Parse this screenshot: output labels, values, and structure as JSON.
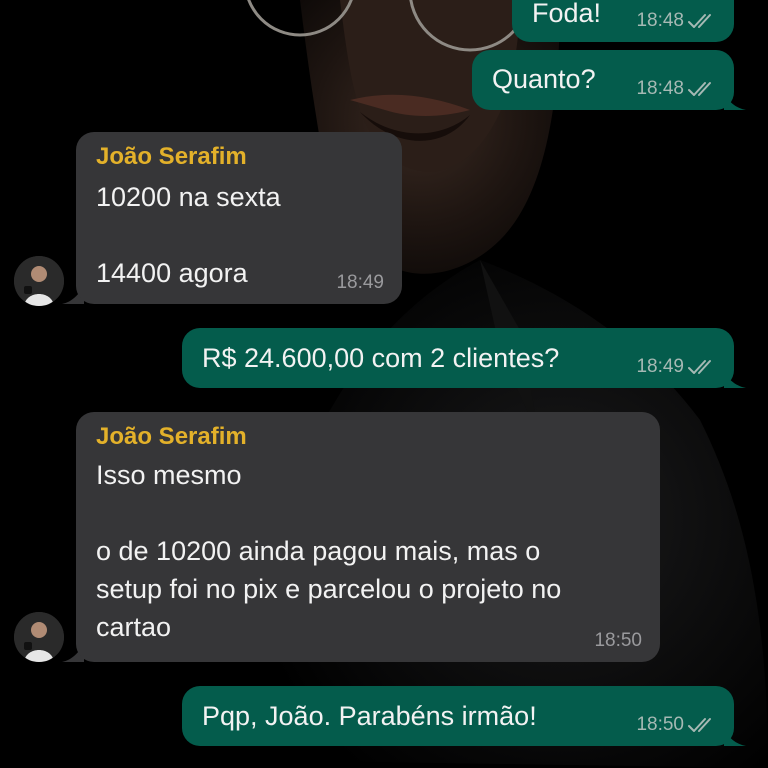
{
  "messages": [
    {
      "id": "m1",
      "direction": "outgoing",
      "text": "Foda!",
      "time": "18:48",
      "status_icon": "double-check-icon"
    },
    {
      "id": "m2",
      "direction": "outgoing",
      "text": "Quanto?",
      "time": "18:48",
      "status_icon": "double-check-icon"
    },
    {
      "id": "m3",
      "direction": "incoming",
      "sender": "João Serafim",
      "text": "10200 na sexta\n\n14400 agora",
      "time": "18:49"
    },
    {
      "id": "m4",
      "direction": "outgoing",
      "text": "R$ 24.600,00 com 2 clientes?",
      "time": "18:49",
      "status_icon": "double-check-icon"
    },
    {
      "id": "m5",
      "direction": "incoming",
      "sender": "João Serafim",
      "text": "Isso mesmo\n\no de 10200 ainda pagou mais, mas o\nsetup foi no pix e parcelou o projeto no\ncartao",
      "time": "18:50"
    },
    {
      "id": "m6",
      "direction": "outgoing",
      "text": "Pqp, João. Parabéns irmão!",
      "time": "18:50",
      "status_icon": "double-check-icon"
    }
  ],
  "colors": {
    "outgoing_bubble": "#045c4c",
    "incoming_bubble": "#363638",
    "sender_name": "#e3b12a",
    "background": "#000000"
  }
}
